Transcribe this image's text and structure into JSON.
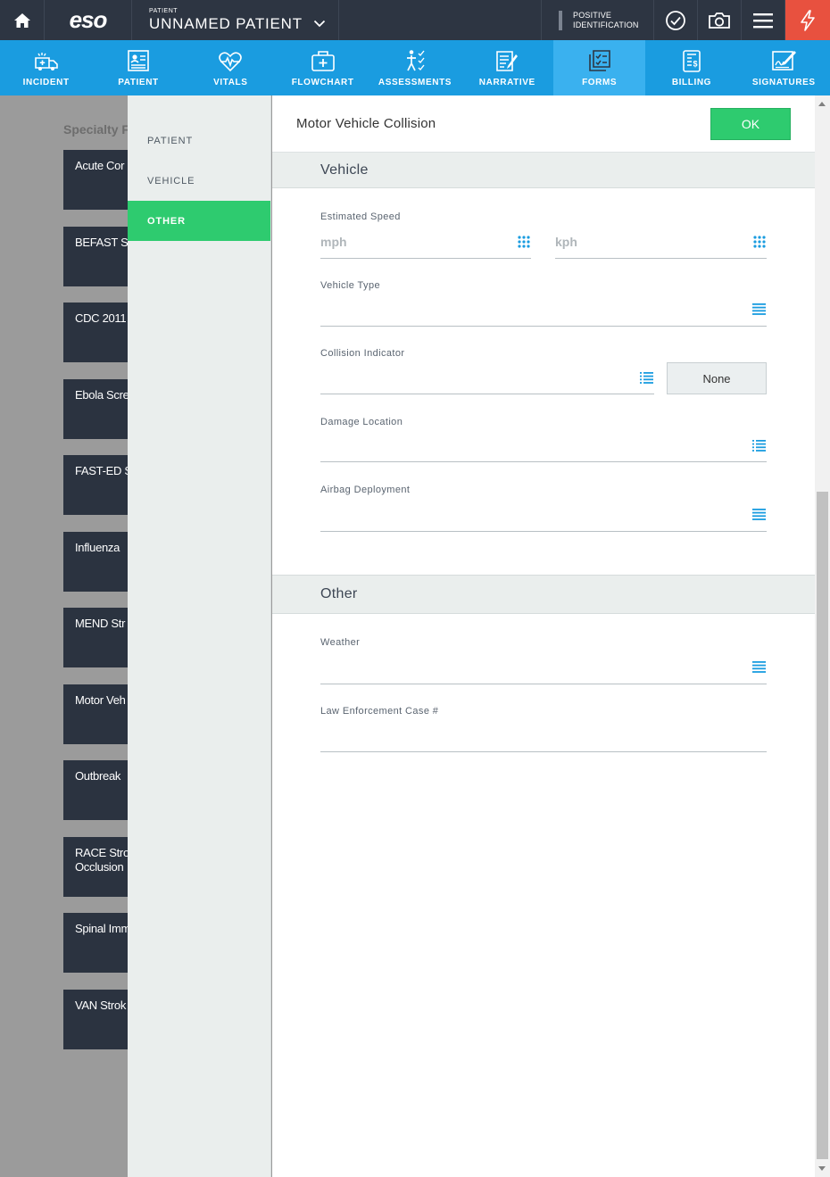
{
  "topbar": {
    "logo": "eso",
    "patient_label": "PATIENT",
    "patient_name": "UNNAMED PATIENT",
    "positive_id_line1": "POSITIVE",
    "positive_id_line2": "IDENTIFICATION"
  },
  "nav": [
    {
      "label": "INCIDENT",
      "icon": "ambulance-icon"
    },
    {
      "label": "PATIENT",
      "icon": "patient-card-icon"
    },
    {
      "label": "VITALS",
      "icon": "heart-pulse-icon"
    },
    {
      "label": "FLOWCHART",
      "icon": "medkit-icon"
    },
    {
      "label": "ASSESSMENTS",
      "icon": "body-check-icon"
    },
    {
      "label": "NARRATIVE",
      "icon": "notepad-icon"
    },
    {
      "label": "FORMS",
      "icon": "forms-icon",
      "active": true
    },
    {
      "label": "BILLING",
      "icon": "billing-icon"
    },
    {
      "label": "SIGNATURES",
      "icon": "signature-icon"
    }
  ],
  "background": {
    "title": "Specialty F",
    "cards": [
      "Acute Cor",
      "BEFAST St",
      "CDC 2011",
      "Ebola Scre",
      "FAST-ED S",
      "Influenza",
      "MEND Str",
      "Motor Veh",
      "Outbreak",
      "RACE Stro\nOcclusion",
      "Spinal Imm",
      "VAN Strok"
    ]
  },
  "side": {
    "items": [
      {
        "label": "PATIENT"
      },
      {
        "label": "VEHICLE"
      },
      {
        "label": "OTHER",
        "active": true
      }
    ]
  },
  "form": {
    "title": "Motor Vehicle Collision",
    "ok_label": "OK",
    "vehicle_section": "Vehicle",
    "estimated_speed_label": "Estimated Speed",
    "mph_placeholder": "mph",
    "kph_placeholder": "kph",
    "vehicle_type_label": "Vehicle Type",
    "collision_indicator_label": "Collision Indicator",
    "none_label": "None",
    "damage_location_label": "Damage Location",
    "airbag_label": "Airbag Deployment",
    "other_section": "Other",
    "weather_label": "Weather",
    "law_case_label": "Law Enforcement Case #"
  },
  "colors": {
    "topbar": "#2d3542",
    "nav": "#1a9ce0",
    "nav_active": "#3ab1ef",
    "accent_green": "#2ecb6f",
    "alert_red": "#e8513f",
    "icon_blue": "#1a9ce0"
  }
}
